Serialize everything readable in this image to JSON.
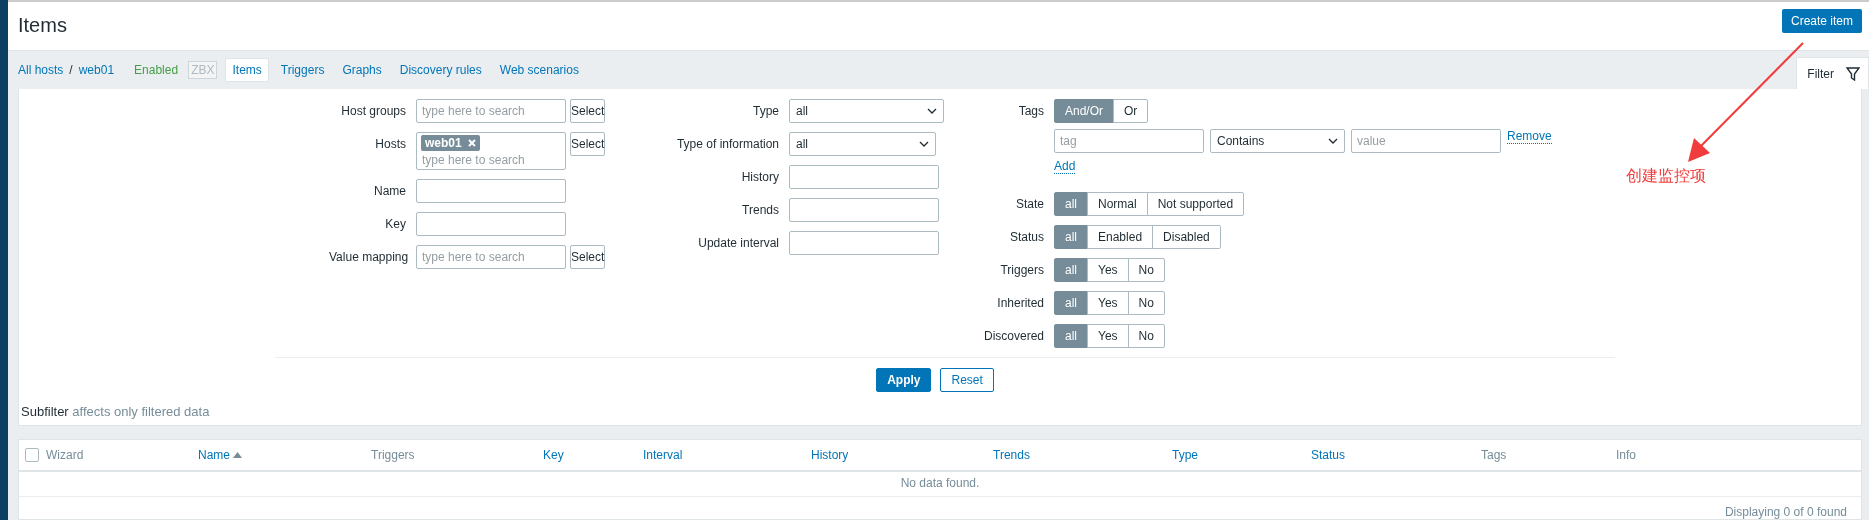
{
  "page": {
    "title": "Items",
    "create_button": "Create item"
  },
  "breadcrumb": {
    "items": [
      "All hosts",
      "web01"
    ],
    "separator": "/"
  },
  "host_status": "Enabled",
  "availability_badge": "ZBX",
  "tabs": [
    {
      "label": "Items",
      "selected": true
    },
    {
      "label": "Triggers",
      "selected": false
    },
    {
      "label": "Graphs",
      "selected": false
    },
    {
      "label": "Discovery rules",
      "selected": false
    },
    {
      "label": "Web scenarios",
      "selected": false
    }
  ],
  "filter_tab": {
    "label": "Filter"
  },
  "filter": {
    "left": [
      {
        "kind": "multiselect",
        "label": "Host groups",
        "placeholder": "type here to search",
        "button": "Select"
      },
      {
        "kind": "multiselect",
        "label": "Hosts",
        "chips": [
          "web01"
        ],
        "placeholder": "type here to search",
        "button": "Select"
      },
      {
        "kind": "text",
        "label": "Name"
      },
      {
        "kind": "text",
        "label": "Key"
      },
      {
        "kind": "multiselect",
        "label": "Value mapping",
        "placeholder": "type here to search",
        "button": "Select"
      }
    ],
    "middle": [
      {
        "kind": "select",
        "label": "Type",
        "value": "all"
      },
      {
        "kind": "select",
        "label": "Type of information",
        "value": "all"
      },
      {
        "kind": "text",
        "label": "History"
      },
      {
        "kind": "text",
        "label": "Trends"
      },
      {
        "kind": "text",
        "label": "Update interval"
      }
    ],
    "tags": {
      "label": "Tags",
      "operators": [
        {
          "label": "And/Or",
          "selected": true
        },
        {
          "label": "Or",
          "selected": false
        }
      ],
      "rows": [
        {
          "tag_placeholder": "tag",
          "operator": "Contains",
          "value_placeholder": "value",
          "remove": "Remove"
        }
      ],
      "add": "Add"
    },
    "segments": [
      {
        "label": "State",
        "options": [
          {
            "label": "all",
            "selected": true
          },
          {
            "label": "Normal",
            "selected": false
          },
          {
            "label": "Not supported",
            "selected": false
          }
        ]
      },
      {
        "label": "Status",
        "options": [
          {
            "label": "all",
            "selected": true
          },
          {
            "label": "Enabled",
            "selected": false
          },
          {
            "label": "Disabled",
            "selected": false
          }
        ]
      },
      {
        "label": "Triggers",
        "options": [
          {
            "label": "all",
            "selected": true
          },
          {
            "label": "Yes",
            "selected": false
          },
          {
            "label": "No",
            "selected": false
          }
        ]
      },
      {
        "label": "Inherited",
        "options": [
          {
            "label": "all",
            "selected": true
          },
          {
            "label": "Yes",
            "selected": false
          },
          {
            "label": "No",
            "selected": false
          }
        ]
      },
      {
        "label": "Discovered",
        "options": [
          {
            "label": "all",
            "selected": true
          },
          {
            "label": "Yes",
            "selected": false
          },
          {
            "label": "No",
            "selected": false
          }
        ]
      }
    ],
    "apply": "Apply",
    "reset": "Reset"
  },
  "subfilter": {
    "title": "Subfilter",
    "note": "affects only filtered data"
  },
  "table": {
    "select_all": {
      "checked": false
    },
    "columns": [
      {
        "label": "Wizard",
        "sortable": false,
        "sorted": false
      },
      {
        "label": "Name",
        "sortable": true,
        "sorted": true
      },
      {
        "label": "Triggers",
        "sortable": false,
        "sorted": false
      },
      {
        "label": "Key",
        "sortable": true,
        "sorted": false
      },
      {
        "label": "Interval",
        "sortable": true,
        "sorted": false
      },
      {
        "label": "History",
        "sortable": true,
        "sorted": false
      },
      {
        "label": "Trends",
        "sortable": true,
        "sorted": false
      },
      {
        "label": "Type",
        "sortable": true,
        "sorted": false
      },
      {
        "label": "Status",
        "sortable": true,
        "sorted": false
      },
      {
        "label": "Tags",
        "sortable": false,
        "sorted": false
      },
      {
        "label": "Info",
        "sortable": false,
        "sorted": false
      }
    ],
    "empty": "No data found.",
    "footer": "Displaying 0 of 0 found"
  },
  "annotation": {
    "text": "创建监控项"
  }
}
